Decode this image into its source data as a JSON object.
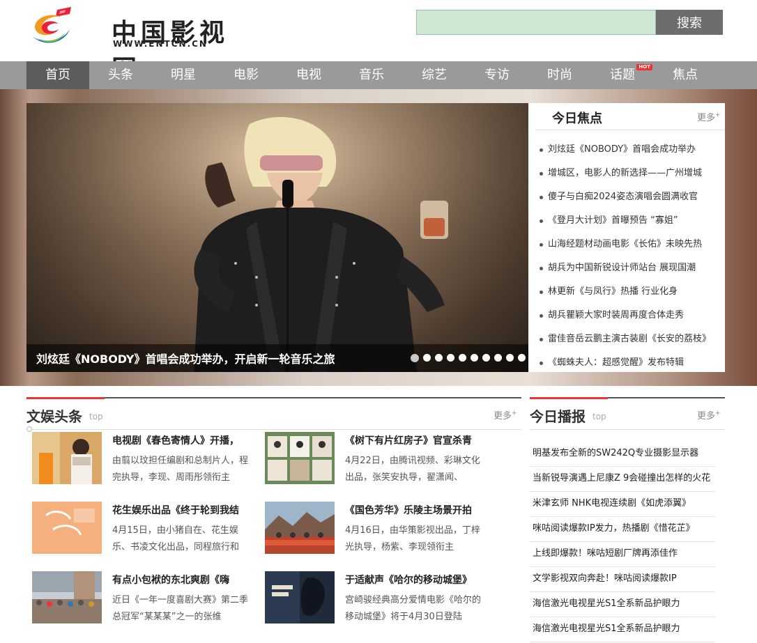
{
  "logo": {
    "name": "中国影视网",
    "url_text": "WWW.ENTCN.CN"
  },
  "search": {
    "placeholder": "",
    "button": "搜索"
  },
  "nav": [
    {
      "label": "首页",
      "active": true
    },
    {
      "label": "头条"
    },
    {
      "label": "明星"
    },
    {
      "label": "电影"
    },
    {
      "label": "电视"
    },
    {
      "label": "音乐"
    },
    {
      "label": "综艺"
    },
    {
      "label": "专访"
    },
    {
      "label": "时尚"
    },
    {
      "label": "话题",
      "badge": "HOT"
    },
    {
      "label": "焦点"
    }
  ],
  "hero": {
    "caption": "刘炫廷《NOBODY》首唱会成功举办，开启新一轮音乐之旅",
    "slide_count": 10,
    "active_slide": 1
  },
  "focus": {
    "title": "今日焦点",
    "more": "更多",
    "items": [
      "刘炫廷《NOBODY》首唱会成功举办",
      "增城区，电影人的新选择——广州增城",
      "傻子与白痴2024姿态演唱会圆满收官",
      "《登月大计划》首曝预告 “寡姐”",
      "山海经题材动画电影《长佑》未映先热",
      "胡兵为中国新锐设计师站台 展现国潮",
      " 林更新《与凤行》热播 行业化身",
      "胡兵瞿颖大家时装周再度合体走秀",
      "雷佳音岳云鹏主演古装剧《长安的荔枝》",
      "《蜘蛛夫人：超感觉醒》发布特辑"
    ]
  },
  "ent": {
    "title": "文娱头条",
    "sub": "top",
    "more": "更多",
    "items": [
      {
        "title": "电视剧《春色寄情人》开播，",
        "desc": "由翦以玟担任编剧和总制片人，程完执导，李现、周雨彤领衔主"
      },
      {
        "title": "《树下有片红房子》官宣杀青",
        "desc": "4月22日，由腾讯视频、彩琳文化出品，张笑安执导，翟潇闻、"
      },
      {
        "title": "花生娱乐出品《终于轮到我结",
        "desc": "4月15日，由小猪自在、花生娱乐、书凌文化出品，同程旅行和"
      },
      {
        "title": "《国色芳华》乐陵主场景开拍",
        "desc": "4月16日，由华策影视出品，丁梓光执导，杨紫、李现领衔主"
      },
      {
        "title": "有点小包袱的东北爽剧《嗨",
        "desc": "近日《一年一度喜剧大赛》第二季总冠军“某某某”之一的张维"
      },
      {
        "title": "于适献声《哈尔的移动城堡》",
        "desc": "宫崎骏经典高分爱情电影《哈尔的移动城堡》将于4月30日登陆"
      }
    ]
  },
  "broadcast": {
    "title": "今日播报",
    "sub": "top",
    "more": "更多",
    "items": [
      "明基发布全新的SW242Q专业摄影显示器",
      "当新锐导演遇上尼康Z 9会碰撞出怎样的火花",
      "米津玄师 NHK电视连续剧《如虎添翼》",
      "咪咕阅读爆款IP发力，热播剧《惜花芷》",
      "上线即爆款！咪咕短剧厂牌再添佳作",
      "文学影视双向奔赴！咪咕阅读爆款IP",
      "海信激光电视星光S1全系新品护眼力",
      "海信激光电视星光S1全系新品护眼力"
    ]
  }
}
